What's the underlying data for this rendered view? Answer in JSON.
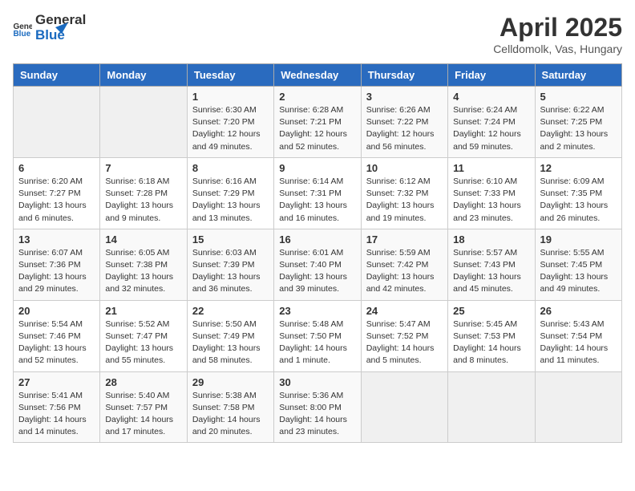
{
  "header": {
    "logo_general": "General",
    "logo_blue": "Blue",
    "title": "April 2025",
    "subtitle": "Celldomolk, Vas, Hungary"
  },
  "days_of_week": [
    "Sunday",
    "Monday",
    "Tuesday",
    "Wednesday",
    "Thursday",
    "Friday",
    "Saturday"
  ],
  "weeks": [
    [
      {
        "day": "",
        "info": ""
      },
      {
        "day": "",
        "info": ""
      },
      {
        "day": "1",
        "info": "Sunrise: 6:30 AM\nSunset: 7:20 PM\nDaylight: 12 hours and 49 minutes."
      },
      {
        "day": "2",
        "info": "Sunrise: 6:28 AM\nSunset: 7:21 PM\nDaylight: 12 hours and 52 minutes."
      },
      {
        "day": "3",
        "info": "Sunrise: 6:26 AM\nSunset: 7:22 PM\nDaylight: 12 hours and 56 minutes."
      },
      {
        "day": "4",
        "info": "Sunrise: 6:24 AM\nSunset: 7:24 PM\nDaylight: 12 hours and 59 minutes."
      },
      {
        "day": "5",
        "info": "Sunrise: 6:22 AM\nSunset: 7:25 PM\nDaylight: 13 hours and 2 minutes."
      }
    ],
    [
      {
        "day": "6",
        "info": "Sunrise: 6:20 AM\nSunset: 7:27 PM\nDaylight: 13 hours and 6 minutes."
      },
      {
        "day": "7",
        "info": "Sunrise: 6:18 AM\nSunset: 7:28 PM\nDaylight: 13 hours and 9 minutes."
      },
      {
        "day": "8",
        "info": "Sunrise: 6:16 AM\nSunset: 7:29 PM\nDaylight: 13 hours and 13 minutes."
      },
      {
        "day": "9",
        "info": "Sunrise: 6:14 AM\nSunset: 7:31 PM\nDaylight: 13 hours and 16 minutes."
      },
      {
        "day": "10",
        "info": "Sunrise: 6:12 AM\nSunset: 7:32 PM\nDaylight: 13 hours and 19 minutes."
      },
      {
        "day": "11",
        "info": "Sunrise: 6:10 AM\nSunset: 7:33 PM\nDaylight: 13 hours and 23 minutes."
      },
      {
        "day": "12",
        "info": "Sunrise: 6:09 AM\nSunset: 7:35 PM\nDaylight: 13 hours and 26 minutes."
      }
    ],
    [
      {
        "day": "13",
        "info": "Sunrise: 6:07 AM\nSunset: 7:36 PM\nDaylight: 13 hours and 29 minutes."
      },
      {
        "day": "14",
        "info": "Sunrise: 6:05 AM\nSunset: 7:38 PM\nDaylight: 13 hours and 32 minutes."
      },
      {
        "day": "15",
        "info": "Sunrise: 6:03 AM\nSunset: 7:39 PM\nDaylight: 13 hours and 36 minutes."
      },
      {
        "day": "16",
        "info": "Sunrise: 6:01 AM\nSunset: 7:40 PM\nDaylight: 13 hours and 39 minutes."
      },
      {
        "day": "17",
        "info": "Sunrise: 5:59 AM\nSunset: 7:42 PM\nDaylight: 13 hours and 42 minutes."
      },
      {
        "day": "18",
        "info": "Sunrise: 5:57 AM\nSunset: 7:43 PM\nDaylight: 13 hours and 45 minutes."
      },
      {
        "day": "19",
        "info": "Sunrise: 5:55 AM\nSunset: 7:45 PM\nDaylight: 13 hours and 49 minutes."
      }
    ],
    [
      {
        "day": "20",
        "info": "Sunrise: 5:54 AM\nSunset: 7:46 PM\nDaylight: 13 hours and 52 minutes."
      },
      {
        "day": "21",
        "info": "Sunrise: 5:52 AM\nSunset: 7:47 PM\nDaylight: 13 hours and 55 minutes."
      },
      {
        "day": "22",
        "info": "Sunrise: 5:50 AM\nSunset: 7:49 PM\nDaylight: 13 hours and 58 minutes."
      },
      {
        "day": "23",
        "info": "Sunrise: 5:48 AM\nSunset: 7:50 PM\nDaylight: 14 hours and 1 minute."
      },
      {
        "day": "24",
        "info": "Sunrise: 5:47 AM\nSunset: 7:52 PM\nDaylight: 14 hours and 5 minutes."
      },
      {
        "day": "25",
        "info": "Sunrise: 5:45 AM\nSunset: 7:53 PM\nDaylight: 14 hours and 8 minutes."
      },
      {
        "day": "26",
        "info": "Sunrise: 5:43 AM\nSunset: 7:54 PM\nDaylight: 14 hours and 11 minutes."
      }
    ],
    [
      {
        "day": "27",
        "info": "Sunrise: 5:41 AM\nSunset: 7:56 PM\nDaylight: 14 hours and 14 minutes."
      },
      {
        "day": "28",
        "info": "Sunrise: 5:40 AM\nSunset: 7:57 PM\nDaylight: 14 hours and 17 minutes."
      },
      {
        "day": "29",
        "info": "Sunrise: 5:38 AM\nSunset: 7:58 PM\nDaylight: 14 hours and 20 minutes."
      },
      {
        "day": "30",
        "info": "Sunrise: 5:36 AM\nSunset: 8:00 PM\nDaylight: 14 hours and 23 minutes."
      },
      {
        "day": "",
        "info": ""
      },
      {
        "day": "",
        "info": ""
      },
      {
        "day": "",
        "info": ""
      }
    ]
  ]
}
